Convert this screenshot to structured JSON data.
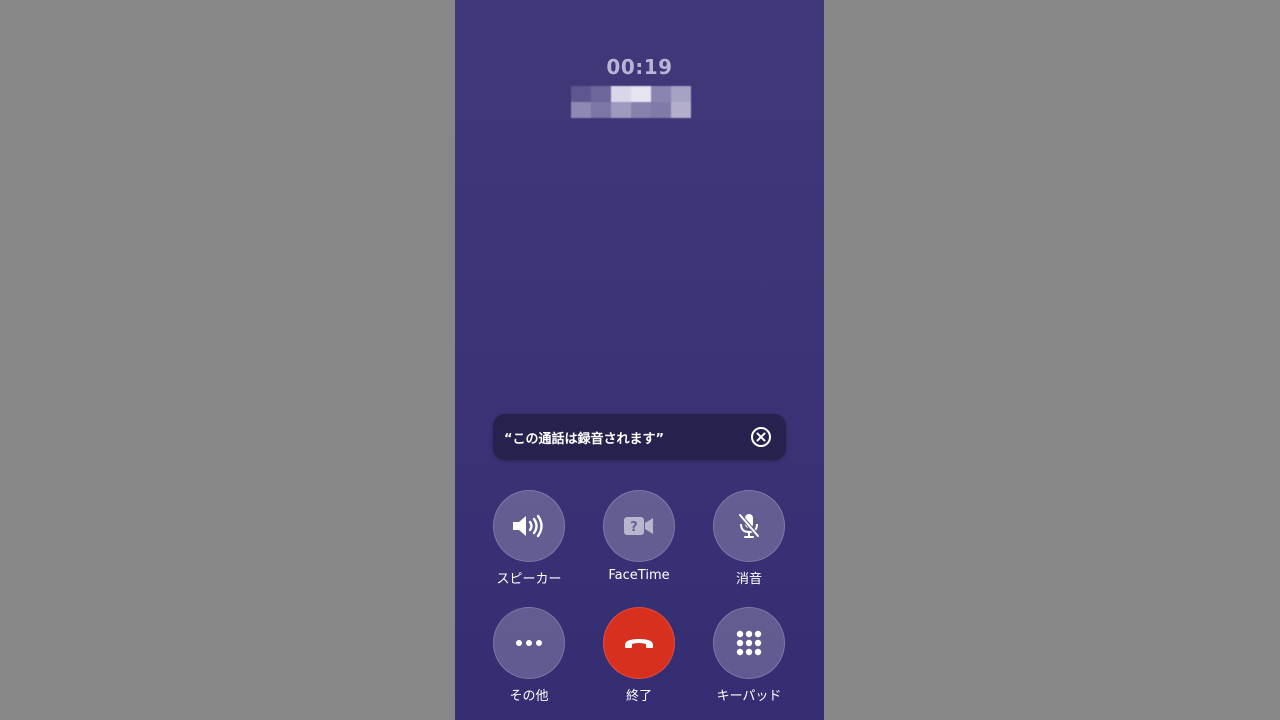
{
  "call": {
    "duration": "00:19",
    "caller_name_redacted": true
  },
  "banner": {
    "text": "“この通話は録音されます”",
    "close_icon": "xmark-circle-icon"
  },
  "controls": {
    "row1": [
      {
        "label": "スピーカー",
        "icon": "speaker-wave-icon"
      },
      {
        "label": "FaceTime",
        "icon": "facetime-question-icon"
      },
      {
        "label": "消音",
        "icon": "mic-slash-icon"
      }
    ],
    "row2": [
      {
        "label": "その他",
        "icon": "ellipsis-icon"
      },
      {
        "label": "終了",
        "icon": "phone-down-icon"
      },
      {
        "label": "キーパッド",
        "icon": "keypad-icon"
      }
    ]
  },
  "colors": {
    "background_top": "#3f397a",
    "background_bottom": "#352d72",
    "end_call": "#d7301f",
    "banner_bg": "#26214d"
  }
}
